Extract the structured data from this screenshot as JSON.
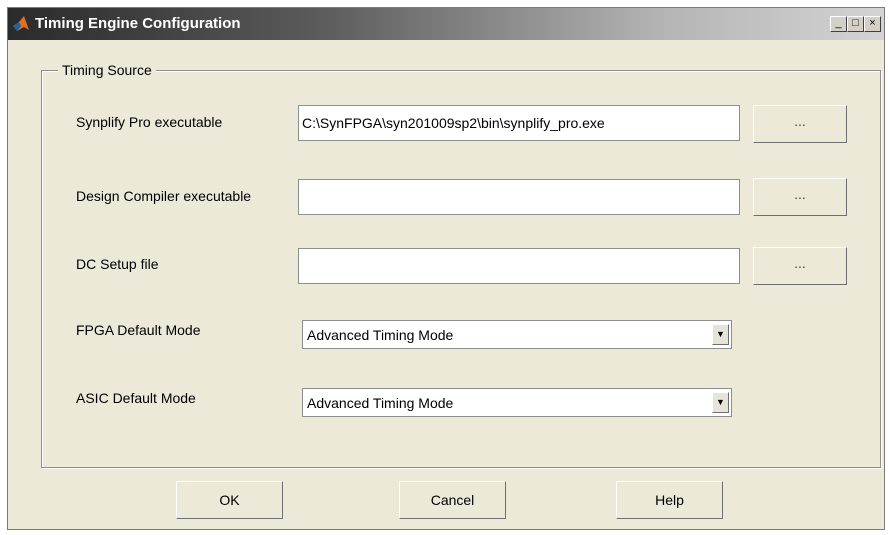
{
  "window": {
    "title": "Timing Engine Configuration",
    "controls": {
      "minimize": "_",
      "maximize": "□",
      "close": "×"
    }
  },
  "group": {
    "label": "Timing Source"
  },
  "rows": [
    {
      "label": "Synplify Pro executable",
      "value": "C:\\SynFPGA\\syn201009sp2\\bin\\synplify_pro.exe",
      "browse": "..."
    },
    {
      "label": "Design Compiler executable",
      "value": "",
      "browse": "..."
    },
    {
      "label": "DC Setup file",
      "value": "",
      "browse": "..."
    }
  ],
  "modes": [
    {
      "label": "FPGA Default Mode",
      "value": "Advanced Timing Mode"
    },
    {
      "label": "ASIC Default Mode",
      "value": "Advanced Timing Mode"
    }
  ],
  "buttons": {
    "ok": "OK",
    "cancel": "Cancel",
    "help": "Help"
  },
  "icons": {
    "app": "matlab-logo-icon",
    "dropdown": "chevron-down-icon"
  }
}
